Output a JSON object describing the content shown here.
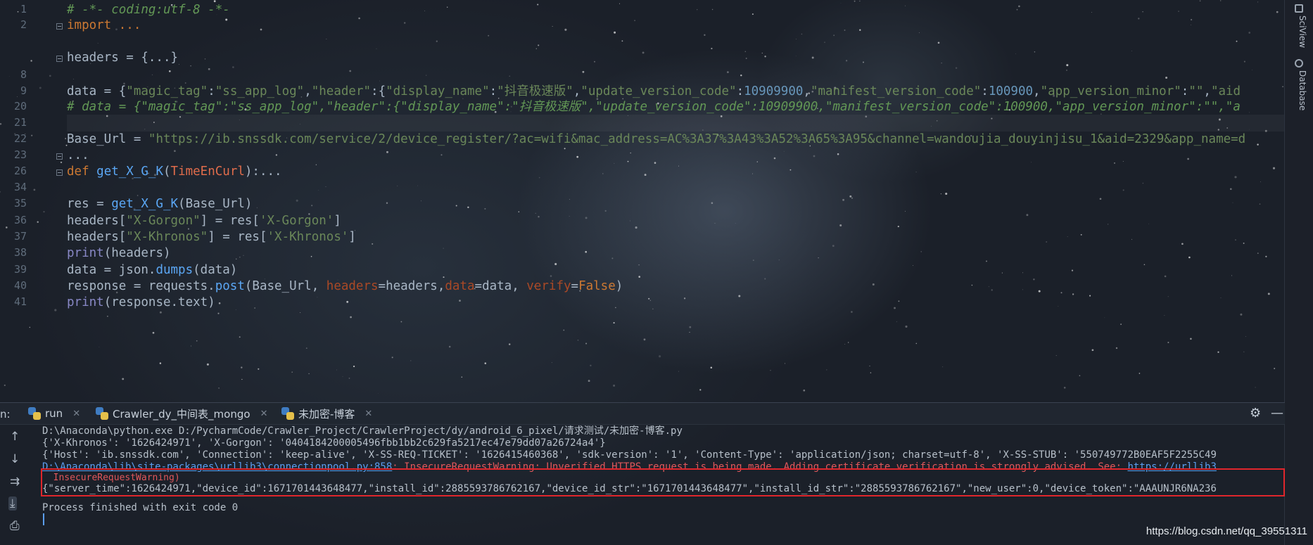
{
  "editor": {
    "lines": [
      {
        "num": "1",
        "segments": [
          {
            "t": "# -*- coding:utf-8 -*-",
            "c": "c-com"
          }
        ]
      },
      {
        "num": "2",
        "fold": true,
        "segments": [
          {
            "t": "import ...",
            "c": "c-kw"
          }
        ]
      },
      {
        "num": "",
        "segments": []
      },
      {
        "num": "",
        "fold": true,
        "segments": [
          {
            "t": "headers = {...}",
            "c": "c-fold"
          }
        ]
      },
      {
        "num": "8",
        "segments": []
      },
      {
        "num": "9",
        "segments": [
          {
            "t": "data = {",
            "c": ""
          },
          {
            "t": "\"magic_tag\"",
            "c": "c-str"
          },
          {
            "t": ":",
            "c": ""
          },
          {
            "t": "\"ss_app_log\"",
            "c": "c-str"
          },
          {
            "t": ",",
            "c": ""
          },
          {
            "t": "\"header\"",
            "c": "c-str"
          },
          {
            "t": ":{",
            "c": ""
          },
          {
            "t": "\"display_name\"",
            "c": "c-str"
          },
          {
            "t": ":",
            "c": ""
          },
          {
            "t": "\"抖音极速版\"",
            "c": "c-str"
          },
          {
            "t": ",",
            "c": ""
          },
          {
            "t": "\"update_version_code\"",
            "c": "c-str"
          },
          {
            "t": ":",
            "c": ""
          },
          {
            "t": "10909900",
            "c": "c-num"
          },
          {
            "t": ",",
            "c": ""
          },
          {
            "t": "\"manifest_version_code\"",
            "c": "c-str"
          },
          {
            "t": ":",
            "c": ""
          },
          {
            "t": "100900",
            "c": "c-num"
          },
          {
            "t": ",",
            "c": ""
          },
          {
            "t": "\"app_version_minor\"",
            "c": "c-str"
          },
          {
            "t": ":",
            "c": ""
          },
          {
            "t": "\"\"",
            "c": "c-str"
          },
          {
            "t": ",",
            "c": ""
          },
          {
            "t": "\"aid",
            "c": "c-str"
          }
        ]
      },
      {
        "num": "20",
        "segments": [
          {
            "t": "# data = {\"magic_tag\":\"ss_app_log\",\"header\":{\"display_name\":\"抖音极速版\",\"update_version_code\":10909900,\"manifest_version_code\":100900,\"app_version_minor\":\"\",\"a",
            "c": "c-com"
          }
        ]
      },
      {
        "num": "21",
        "cur": true,
        "segments": []
      },
      {
        "num": "22",
        "segments": [
          {
            "t": "Base_Url = ",
            "c": ""
          },
          {
            "t": "\"https://ib.snssdk.com/service/2/device_register/?ac=wifi&mac_address=AC%3A37%3A43%3A52%3A65%3A95&channel=wandoujia_douyinjisu_1&aid=2329&app_name=d",
            "c": "c-str"
          }
        ]
      },
      {
        "num": "23",
        "fold": true,
        "segments": [
          {
            "t": "...",
            "c": "c-fold"
          }
        ]
      },
      {
        "num": "26",
        "fold": true,
        "segments": [
          {
            "t": "def ",
            "c": "c-kw"
          },
          {
            "t": "get_X_G_K",
            "c": "c-fn"
          },
          {
            "t": "(",
            "c": ""
          },
          {
            "t": "TimeEnCurl",
            "c": "c-paramname"
          },
          {
            "t": "):...",
            "c": ""
          }
        ]
      },
      {
        "num": "34",
        "segments": []
      },
      {
        "num": "35",
        "segments": [
          {
            "t": "res = ",
            "c": ""
          },
          {
            "t": "get_X_G_K",
            "c": "c-fn"
          },
          {
            "t": "(Base_Url)",
            "c": ""
          }
        ]
      },
      {
        "num": "36",
        "segments": [
          {
            "t": "headers[",
            "c": ""
          },
          {
            "t": "\"X-Gorgon\"",
            "c": "c-str"
          },
          {
            "t": "] = res[",
            "c": ""
          },
          {
            "t": "'X-Gorgon'",
            "c": "c-str"
          },
          {
            "t": "]",
            "c": ""
          }
        ]
      },
      {
        "num": "37",
        "segments": [
          {
            "t": "headers[",
            "c": ""
          },
          {
            "t": "\"X-Khronos\"",
            "c": "c-str"
          },
          {
            "t": "] = res[",
            "c": ""
          },
          {
            "t": "'X-Khronos'",
            "c": "c-str"
          },
          {
            "t": "]",
            "c": ""
          }
        ]
      },
      {
        "num": "38",
        "segments": [
          {
            "t": "print",
            "c": "c-builtin"
          },
          {
            "t": "(headers)",
            "c": ""
          }
        ]
      },
      {
        "num": "39",
        "segments": [
          {
            "t": "data = json.",
            "c": ""
          },
          {
            "t": "dumps",
            "c": "c-fn"
          },
          {
            "t": "(data)",
            "c": ""
          }
        ]
      },
      {
        "num": "40",
        "segments": [
          {
            "t": "response = requests.",
            "c": ""
          },
          {
            "t": "post",
            "c": "c-fn"
          },
          {
            "t": "(Base_Url, ",
            "c": ""
          },
          {
            "t": "headers",
            "c": "c-kwarg"
          },
          {
            "t": "=headers,",
            "c": ""
          },
          {
            "t": "data",
            "c": "c-kwarg"
          },
          {
            "t": "=data, ",
            "c": ""
          },
          {
            "t": "verify",
            "c": "c-kwarg"
          },
          {
            "t": "=",
            "c": ""
          },
          {
            "t": "False",
            "c": "c-bool"
          },
          {
            "t": ")",
            "c": ""
          }
        ]
      },
      {
        "num": "41",
        "segments": [
          {
            "t": "print",
            "c": "c-builtin"
          },
          {
            "t": "(response.text)",
            "c": ""
          }
        ]
      }
    ]
  },
  "right_toolbar": {
    "sciview": "SciView",
    "database": "Database"
  },
  "run_panel": {
    "label": "n:",
    "tabs": [
      {
        "label": "run"
      },
      {
        "label": "Crawler_dy_中间表_mongo"
      },
      {
        "label": "未加密-博客"
      }
    ],
    "settings_icon": "⚙",
    "minimize_icon": "—",
    "console": {
      "cmd": "D:\\Anaconda\\python.exe D:/PycharmCode/Crawler_Project/CrawlerProject/dy/android_6_pixel/请求测试/未加密-博客.py",
      "out1": "{'X-Khronos': '1626424971', 'X-Gorgon': '0404184200005496fbb1bb2c629fa5217ec47e79dd07a26724a4'}",
      "out2": "{'Host': 'ib.snssdk.com', 'Connection': 'keep-alive', 'X-SS-REQ-TICKET': '1626415460368', 'sdk-version': '1', 'Content-Type': 'application/json; charset=utf-8', 'X-SS-STUB': '550749772B0EAF5F2255C49",
      "warn_path": "D:\\Anaconda\\lib\\site-packages\\urllib3\\connectionpool.py:858",
      "warn_msg": ": InsecureRequestWarning: Unverified HTTPS request is being made. Adding certificate verification is strongly advised. See: ",
      "warn_link": "https://urllib3",
      "warn_cont": "  InsecureRequestWarning)",
      "response": "{\"server_time\":1626424971,\"device_id\":1671701443648477,\"install_id\":2885593786762167,\"device_id_str\":\"1671701443648477\",\"install_id_str\":\"2885593786762167\",\"new_user\":0,\"device_token\":\"AAAUNJR6NA236",
      "exit": "Process finished with exit code 0"
    }
  },
  "watermark": "https://blog.csdn.net/qq_39551311"
}
